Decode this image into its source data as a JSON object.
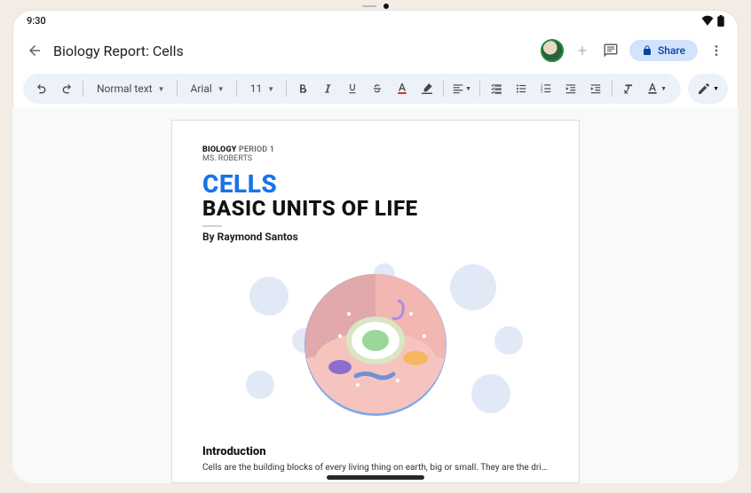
{
  "status": {
    "time": "9:30"
  },
  "header": {
    "title": "Biology Report: Cells",
    "share_label": "Share"
  },
  "toolbar": {
    "style_label": "Normal text",
    "font_label": "Arial",
    "size_label": "11"
  },
  "doc": {
    "kicker_bold": "BIOLOGY",
    "kicker_rest": " PERIOD 1",
    "teacher": "MS. ROBERTS",
    "title_line1": "CELLS",
    "title_line2": "BASIC UNITS OF LIFE",
    "byline": "By Raymond Santos",
    "section_heading": "Introduction",
    "section_text": "Cells are the building blocks of every living thing on earth, big or small. They are the drivers"
  }
}
